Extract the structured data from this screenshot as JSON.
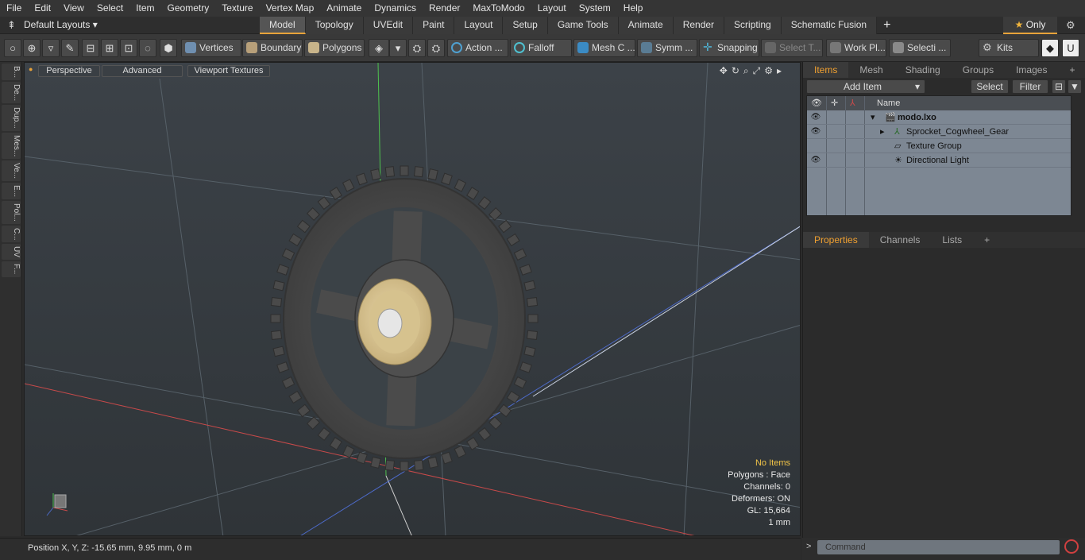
{
  "menu": [
    "File",
    "Edit",
    "View",
    "Select",
    "Item",
    "Geometry",
    "Texture",
    "Vertex Map",
    "Animate",
    "Dynamics",
    "Render",
    "MaxToModo",
    "Layout",
    "System",
    "Help"
  ],
  "layouts": {
    "label": "Default Layouts",
    "tabs": [
      "Model",
      "Topology",
      "UVEdit",
      "Paint",
      "Layout",
      "Setup",
      "Game Tools",
      "Animate",
      "Render",
      "Scripting",
      "Schematic Fusion"
    ],
    "active": "Model",
    "only": "Only"
  },
  "toolbar": {
    "vertices": "Vertices",
    "boundary": "Boundary",
    "polygons": "Polygons",
    "action": "Action",
    "falloff": "Falloff",
    "mesh": "Mesh C ...",
    "symm": "Symm ...",
    "snapping": "Snapping",
    "select_t": "Select T...",
    "work_pl": "Work Pl...",
    "selecti": "Selecti ...",
    "kits": "Kits"
  },
  "left_tabs": [
    "B...",
    "De...",
    "Dup...",
    "Mes...",
    "Ve...",
    "E...",
    "Pol...",
    "C...",
    "UV",
    "F..."
  ],
  "viewport": {
    "perspective": "Perspective",
    "advanced": "Advanced",
    "textures": "Viewport Textures"
  },
  "info": {
    "no_items": "No Items",
    "polygons": "Polygons : Face",
    "channels": "Channels: 0",
    "deformers": "Deformers: ON",
    "gl": "GL: 15,664",
    "unit": "1 mm"
  },
  "status": {
    "position": "Position X, Y, Z:   -15.65 mm, 9.95 mm, 0 m"
  },
  "items_panel": {
    "tabs": [
      "Items",
      "Mesh ...",
      "Shading",
      "Groups",
      "Images"
    ],
    "add_item": "Add Item",
    "select": "Select",
    "filter": "Filter",
    "name_header": "Name",
    "rows": [
      {
        "label": "modo.lxo"
      },
      {
        "label": "Sprocket_Cogwheel_Gear"
      },
      {
        "label": "Texture Group"
      },
      {
        "label": "Directional Light"
      }
    ]
  },
  "props_panel": {
    "tabs": [
      "Properties",
      "Channels",
      "Lists"
    ]
  },
  "command": {
    "placeholder": "Command"
  }
}
